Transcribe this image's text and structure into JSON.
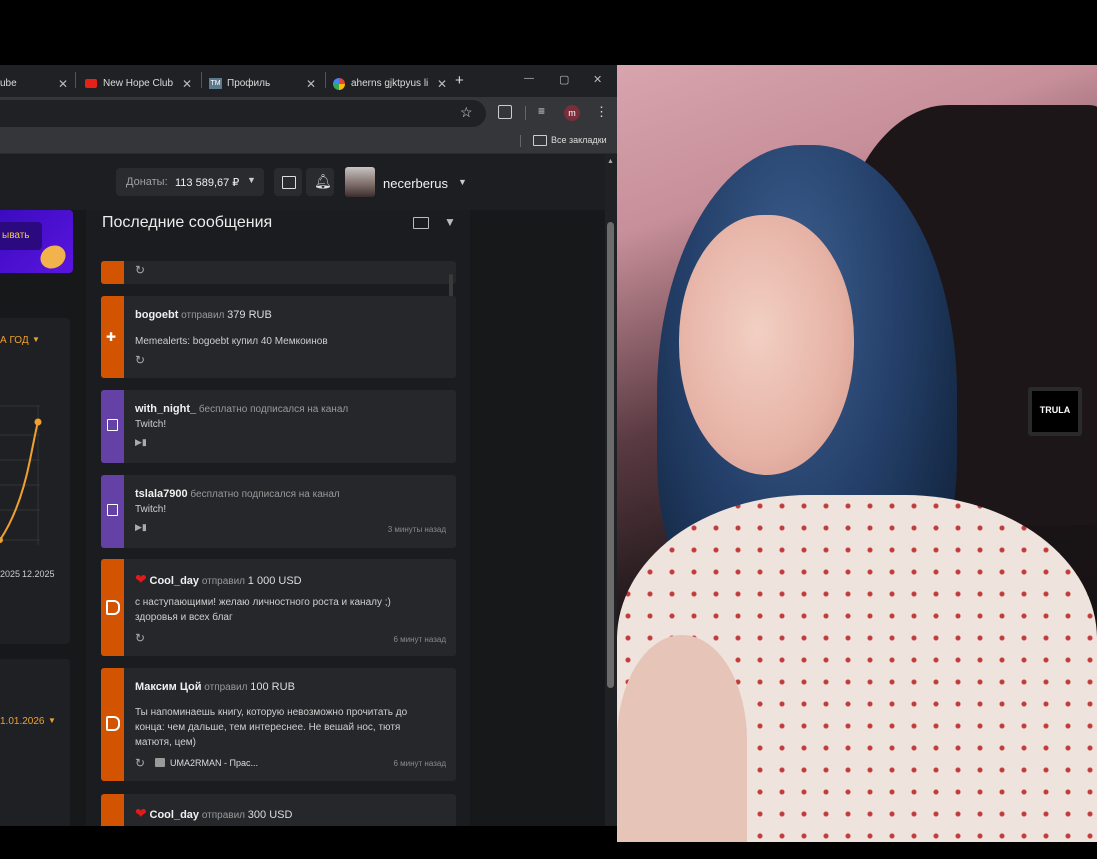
{
  "browser": {
    "tabs": [
      {
        "title": "ube",
        "icon": "youtube-icon"
      },
      {
        "title": "New Hope Club -",
        "icon": "youtube-icon"
      },
      {
        "title": "Профиль",
        "icon": "tm-icon"
      },
      {
        "title": "aherns gjktpyus li",
        "icon": "google-icon"
      }
    ],
    "new_tab": "+",
    "bookmarks_label": "Все закладки",
    "profile_initial": "m",
    "window_controls": [
      "—",
      "▢",
      "✕"
    ]
  },
  "topnav": {
    "donations_label": "Донаты:",
    "donations_value": "113 589,67 ₽",
    "username": "necerberus"
  },
  "left_panel": {
    "banner_button": "ывать",
    "period_label": "А ГОД",
    "date_label": "1.01.2026",
    "x_labels": [
      "2025",
      "12.2025"
    ]
  },
  "messages": {
    "title": "Последние сообщения",
    "items": [
      {
        "user": "bogoebt",
        "action": "отправил",
        "amount": "379 RUB",
        "text": "Memealerts: bogoebt купил 40 Мемкоинов",
        "time": "",
        "color": "#d35400"
      },
      {
        "user": "with_night_",
        "action": "бесплатно подписался на канал",
        "amount": "",
        "text": "Twitch!",
        "time": "",
        "color": "#6441a5"
      },
      {
        "user": "tslala7900",
        "action": "бесплатно подписался на канал",
        "amount": "",
        "text": "Twitch!",
        "time": "3 минуты назад",
        "color": "#6441a5"
      },
      {
        "user": "Cool_day",
        "action": "отправил",
        "amount": "1 000 USD",
        "text": "с наступающими! желаю личностного роста и каналу ;)",
        "text2": "здоровья и всех благ",
        "time": "6 минут назад",
        "color": "#d35400"
      },
      {
        "user": "Максим Цой",
        "action": "отправил",
        "amount": "100 RUB",
        "text": "Ты напоминаешь книгу, которую невозможно прочитать до",
        "text2": "конца: чем дальше, тем интереснее. Не вешай нос, тютя",
        "text3": "матютя, цем)",
        "media": "UMA2RMAN - Прас...",
        "time": "6 минут назад",
        "color": "#d35400"
      },
      {
        "user": "Cool_day",
        "action": "отправил",
        "amount": "300 USD",
        "text": "",
        "time": "",
        "color": "#d35400"
      }
    ]
  },
  "overlay": {
    "badge": "TRULA"
  }
}
